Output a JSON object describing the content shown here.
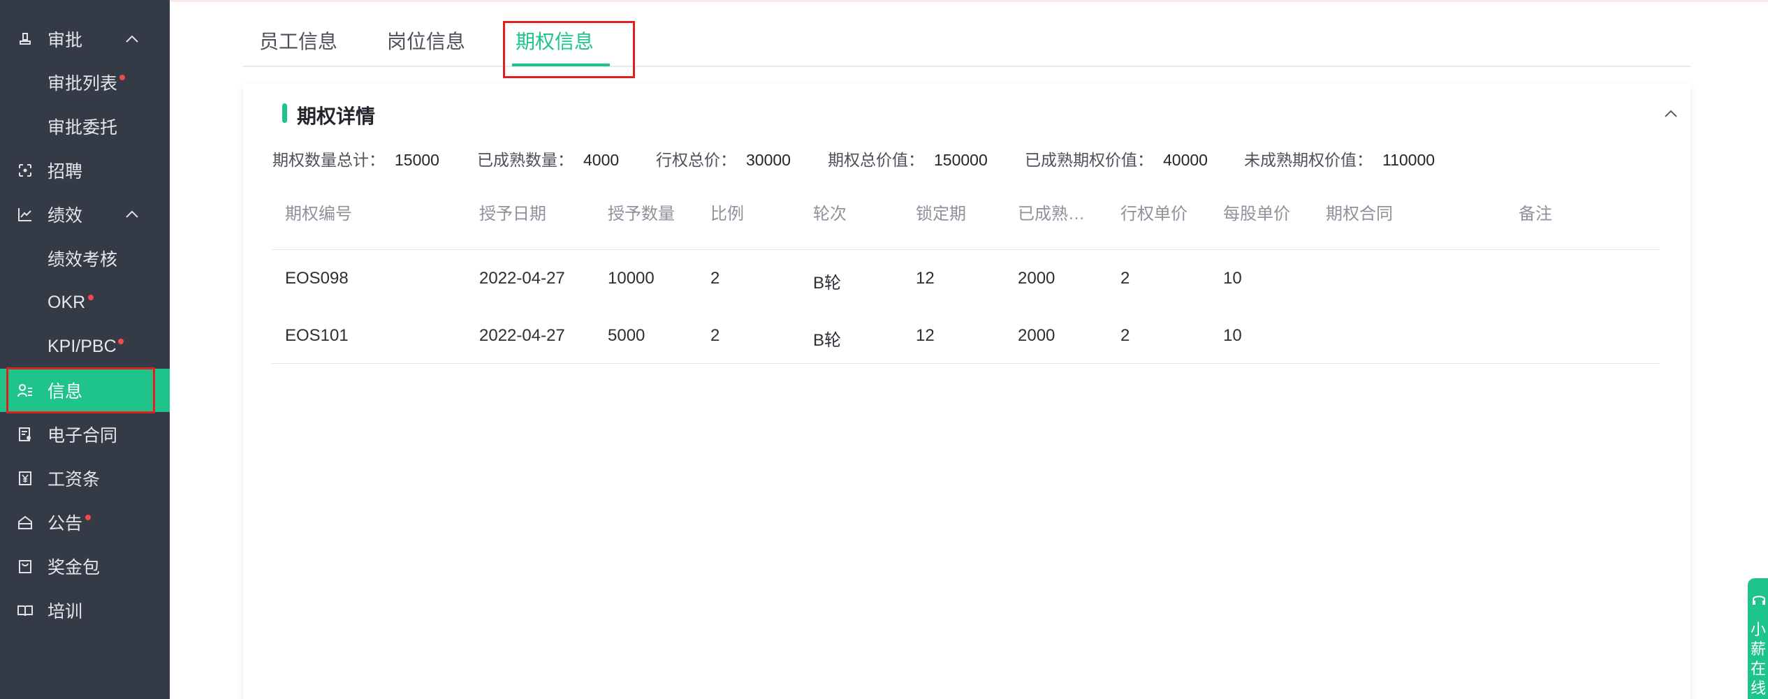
{
  "sidebar": {
    "items": [
      {
        "label": "审批",
        "icon": "stamp-icon",
        "expanded": true
      },
      {
        "label": "审批列表",
        "sub": true,
        "badge": true
      },
      {
        "label": "审批委托",
        "sub": true
      },
      {
        "label": "招聘",
        "icon": "recruit-icon"
      },
      {
        "label": "绩效",
        "icon": "chart-line-icon",
        "expanded": true
      },
      {
        "label": "绩效考核",
        "sub": true
      },
      {
        "label": "OKR",
        "sub": true,
        "badge": true
      },
      {
        "label": "KPI/PBC",
        "sub": true,
        "badge": true
      },
      {
        "label": "信息",
        "icon": "user-info-icon",
        "active": true
      },
      {
        "label": "电子合同",
        "icon": "contract-icon"
      },
      {
        "label": "工资条",
        "icon": "salary-icon"
      },
      {
        "label": "公告",
        "icon": "announcement-icon",
        "badge": true
      },
      {
        "label": "奖金包",
        "icon": "bonus-icon"
      },
      {
        "label": "培训",
        "icon": "training-icon"
      }
    ]
  },
  "tabs": [
    {
      "label": "员工信息"
    },
    {
      "label": "岗位信息"
    },
    {
      "label": "期权信息",
      "active": true
    }
  ],
  "card": {
    "title": "期权详情"
  },
  "summary": [
    {
      "label": "期权数量总计：",
      "value": "15000"
    },
    {
      "label": "已成熟数量：",
      "value": "4000"
    },
    {
      "label": "行权总价：",
      "value": "30000"
    },
    {
      "label": "期权总价值：",
      "value": "150000"
    },
    {
      "label": "已成熟期权价值：",
      "value": "40000"
    },
    {
      "label": "未成熟期权价值：",
      "value": "110000"
    }
  ],
  "table": {
    "headers": [
      "期权编号",
      "授予日期",
      "授予数量",
      "比例",
      "轮次",
      "锁定期",
      "已成熟…",
      "行权单价",
      "每股单价",
      "期权合同",
      "备注"
    ],
    "rows": [
      [
        "EOS098",
        "2022-04-27",
        "10000",
        "2",
        "B轮",
        "12",
        "2000",
        "2",
        "10",
        "",
        ""
      ],
      [
        "EOS101",
        "2022-04-27",
        "5000",
        "2",
        "B轮",
        "12",
        "2000",
        "2",
        "10",
        "",
        ""
      ]
    ]
  },
  "float_help": {
    "label": "小薪在线"
  },
  "colors": {
    "accent": "#1ec48a",
    "sidebar_bg": "#343a46",
    "highlight_border": "#e01f1f",
    "badge": "#f24a4a"
  }
}
